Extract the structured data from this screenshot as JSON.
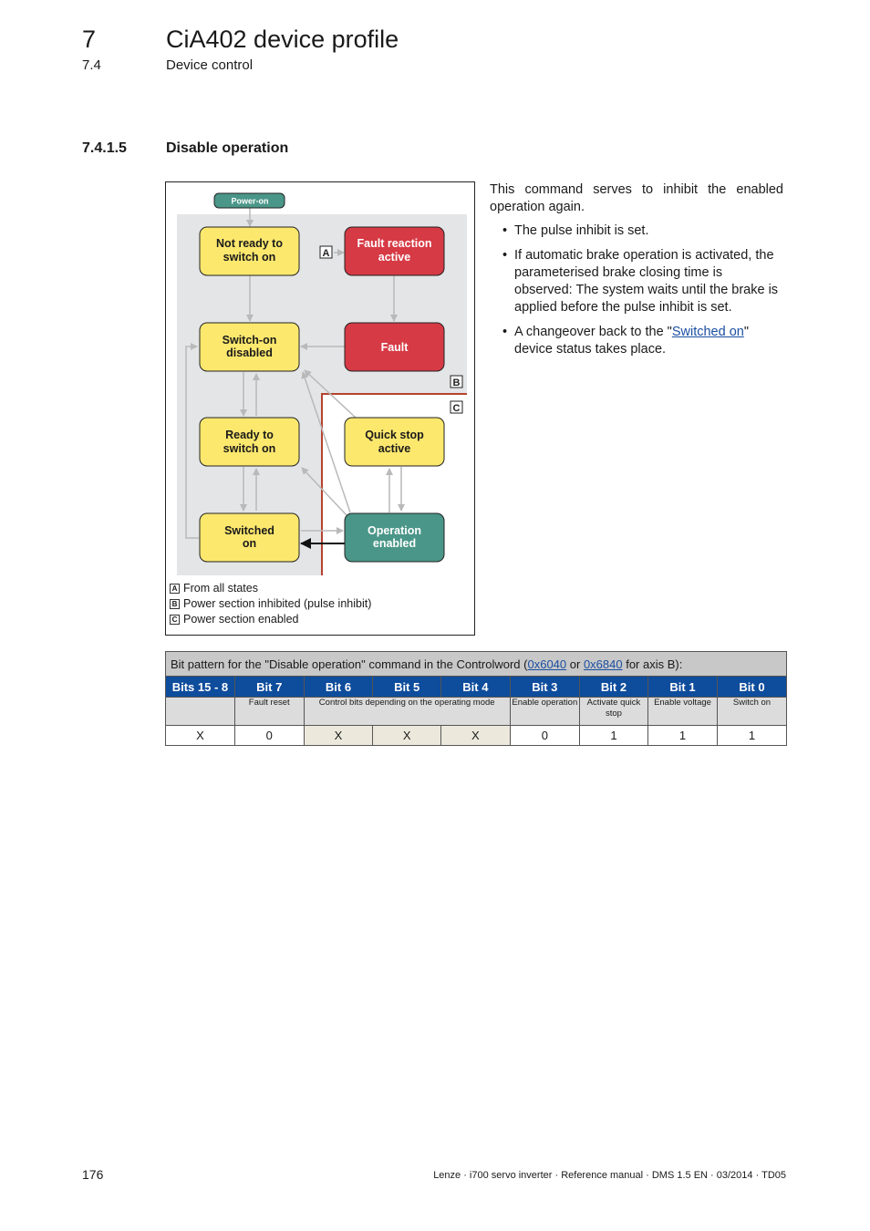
{
  "header": {
    "chapter_number": "7",
    "chapter_title": "CiA402 device profile",
    "section_number": "7.4",
    "section_title": "Device control",
    "rule": "_ _ _ _ _ _ _ _ _ _ _ _ _ _ _ _ _ _ _ _ _ _ _ _ _ _ _ _ _ _ _ _ _ _ _ _ _ _ _ _ _ _ _ _ _ _ _ _ _ _ _ _ _ _ _ _ _ _ _ _ _ _ _ _ _ _"
  },
  "subsection": {
    "number": "7.4.1.5",
    "title": "Disable operation"
  },
  "diagram": {
    "power_on": "Power-on",
    "states": {
      "not_ready": [
        "Not ready to",
        "switch on"
      ],
      "fault_reaction": [
        "Fault reaction",
        "active"
      ],
      "switch_on_disabled": [
        "Switch-on",
        "disabled"
      ],
      "fault": [
        "Fault"
      ],
      "ready": [
        "Ready to",
        "switch on"
      ],
      "quick_stop": [
        "Quick stop",
        "active"
      ],
      "switched_on": [
        "Switched",
        "on"
      ],
      "operation_enabled": [
        "Operation",
        "enabled"
      ]
    },
    "markers": {
      "a": "A",
      "b": "B",
      "c": "C"
    },
    "colors": {
      "yellow": "#fde86e",
      "red": "#d63a45",
      "teal": "#4a9688",
      "gray_area": "#e4e5e7",
      "arrow": "#b9b9b9",
      "enabled_border": "#b5432f",
      "active_arrow": "#111111"
    },
    "legend": [
      {
        "key": "A",
        "text": "From all states"
      },
      {
        "key": "B",
        "text": "Power section inhibited (pulse inhibit)"
      },
      {
        "key": "C",
        "text": "Power section enabled"
      }
    ]
  },
  "body": {
    "intro": "This command serves to inhibit the enabled operation again.",
    "bullets": {
      "b1": "The pulse inhibit is set.",
      "b2": "If automatic brake operation is activated, the parameterised brake closing time is observed: The system waits until the brake is applied before the pulse inhibit is set.",
      "b3_pre": "A changeover back to the \"",
      "b3_link": "Switched on",
      "b3_post": "\" device status takes place."
    }
  },
  "table": {
    "caption_pre": "Bit pattern for the \"Disable operation\" command in the Controlword (",
    "caption_link1": "0x6040",
    "caption_mid": " or ",
    "caption_link2": "0x6840",
    "caption_post": " for axis B):",
    "headers": [
      "Bits 15 - 8",
      "Bit 7",
      "Bit 6",
      "Bit 5",
      "Bit 4",
      "Bit 3",
      "Bit 2",
      "Bit 1",
      "Bit 0"
    ],
    "descriptions": {
      "bits15_8": "",
      "bit7": "Fault reset",
      "bit6_4": "Control bits depending on the operating mode",
      "bit3": "Enable operation",
      "bit2": "Activate quick stop",
      "bit1": "Enable voltage",
      "bit0": "Switch on"
    },
    "values": [
      "X",
      "0",
      "X",
      "X",
      "X",
      "0",
      "1",
      "1",
      "1"
    ]
  },
  "footer": {
    "page_number": "176",
    "doc_info": "Lenze · i700 servo inverter · Reference manual · DMS 1.5 EN · 03/2014 · TD05"
  }
}
